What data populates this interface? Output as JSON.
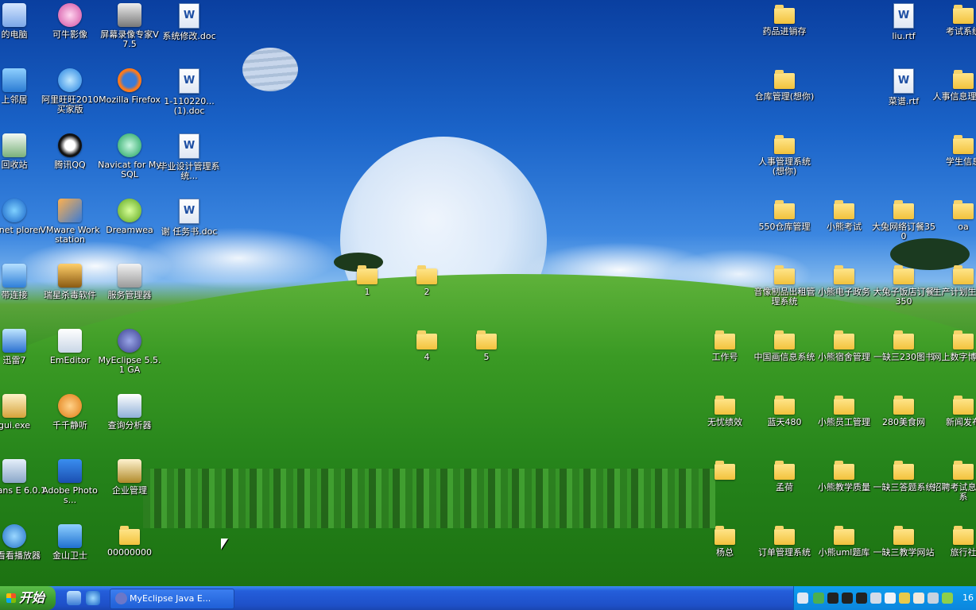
{
  "colors": {
    "folder": "#f2c23c",
    "taskbar": "#245edb",
    "start": "#3a9a2c",
    "tray": "#0b86dd"
  },
  "icons_left": [
    {
      "label": "的电脑",
      "icon": "computer-icon"
    },
    {
      "label": "上邻居",
      "icon": "network-icon"
    },
    {
      "label": "回收站",
      "icon": "recycle-bin-icon"
    },
    {
      "label": "ternet plorer",
      "icon": "ie-icon"
    },
    {
      "label": "带连接",
      "icon": "broadband-icon"
    },
    {
      "label": "迅雷7",
      "icon": "thunder-icon"
    },
    {
      "label": "gui.exe",
      "icon": "app-icon"
    },
    {
      "label": "tBeans E 6.0.1",
      "icon": "netbeans-icon"
    },
    {
      "label": "看看看播放器",
      "icon": "player-icon"
    }
  ],
  "icons_col2": [
    {
      "label": "可牛影像",
      "icon": "kniu-icon"
    },
    {
      "label": "阿里旺旺2010 买家版",
      "icon": "aliwangwang-icon"
    },
    {
      "label": "腾讯QQ",
      "icon": "qq-icon"
    },
    {
      "label": "VMware Workstation",
      "icon": "vmware-icon"
    },
    {
      "label": "瑞星杀毒软件",
      "icon": "rising-icon"
    },
    {
      "label": "EmEditor",
      "icon": "emeditor-icon"
    },
    {
      "label": "千千静听",
      "icon": "ttplayer-icon"
    },
    {
      "label": "Adobe Photos...",
      "icon": "photoshop-icon"
    },
    {
      "label": "金山卫士",
      "icon": "kingsoft-icon"
    }
  ],
  "icons_col3": [
    {
      "label": "屏幕录像专家V7.5",
      "icon": "recorder-icon"
    },
    {
      "label": "Mozilla Firefox",
      "icon": "firefox-icon"
    },
    {
      "label": "Navicat for MySQL",
      "icon": "navicat-icon"
    },
    {
      "label": "Dreamwea",
      "icon": "dreamweaver-icon"
    },
    {
      "label": "服务管理器",
      "icon": "service-manager-icon"
    },
    {
      "label": "MyEclipse 5.5.1 GA",
      "icon": "myeclipse-icon"
    },
    {
      "label": "查询分析器",
      "icon": "query-analyzer-icon"
    },
    {
      "label": "企业管理",
      "icon": "enterprise-manager-icon"
    },
    {
      "label": "00000000",
      "icon": "folder-icon"
    }
  ],
  "icons_col4": [
    {
      "label": "系统修改.doc",
      "icon": "word-doc-icon"
    },
    {
      "label": "1-110220...(1).doc",
      "icon": "word-doc-icon"
    },
    {
      "label": "毕业设计管理系统...",
      "icon": "word-doc-icon"
    },
    {
      "label": "谢 任务书.doc",
      "icon": "word-doc-icon"
    }
  ],
  "mid_folders": [
    {
      "label": "1"
    },
    {
      "label": "2"
    },
    {
      "label": "4"
    },
    {
      "label": "5"
    }
  ],
  "right_c1": [
    {
      "label": "工作号"
    },
    {
      "label": "无忧绩效"
    },
    {
      "label": ""
    },
    {
      "label": "杨总"
    }
  ],
  "right_c2": [
    {
      "label": "药品进销存"
    },
    {
      "label": "仓库管理(想你)"
    },
    {
      "label": "人事管理系统(想你)"
    },
    {
      "label": "550仓库管理"
    },
    {
      "label": "音像制品出租管理系统"
    },
    {
      "label": "中国画信息系统"
    },
    {
      "label": "蓝天480"
    },
    {
      "label": "孟荷"
    },
    {
      "label": "订单管理系统"
    }
  ],
  "right_c3": [
    {
      "label": "小熊考试"
    },
    {
      "label": "小熊电子政务"
    },
    {
      "label": "小熊宿舍管理"
    },
    {
      "label": "小熊员工管理"
    },
    {
      "label": "小熊教学质量"
    },
    {
      "label": "小熊uml题库"
    }
  ],
  "right_c4": [
    {
      "label": "liu.rtf",
      "icon": "rtf-doc-icon"
    },
    {
      "label": "菜谱.rtf",
      "icon": "rtf-doc-icon"
    },
    {
      "label": "大兔网络订餐350",
      "icon": "folder-icon"
    },
    {
      "label": "大兔子饭店订餐350",
      "icon": "folder-icon"
    },
    {
      "label": "一缺三230图书",
      "icon": "folder-icon"
    },
    {
      "label": "280美食网",
      "icon": "folder-icon"
    },
    {
      "label": "一缺三答题系统",
      "icon": "folder-icon"
    },
    {
      "label": "一缺三教学网站",
      "icon": "folder-icon"
    }
  ],
  "right_c5": [
    {
      "label": "考试系统"
    },
    {
      "label": "人事信息理系统"
    },
    {
      "label": "学生信息"
    },
    {
      "label": "oa"
    },
    {
      "label": "生产计划生产进"
    },
    {
      "label": "网上数字博物馆"
    },
    {
      "label": "新闻发布"
    },
    {
      "label": "招聘考试息管理系"
    },
    {
      "label": "旅行社"
    }
  ],
  "taskbar": {
    "start_label": "开始",
    "task_label": "MyEclipse Java E...",
    "clock": "16"
  }
}
